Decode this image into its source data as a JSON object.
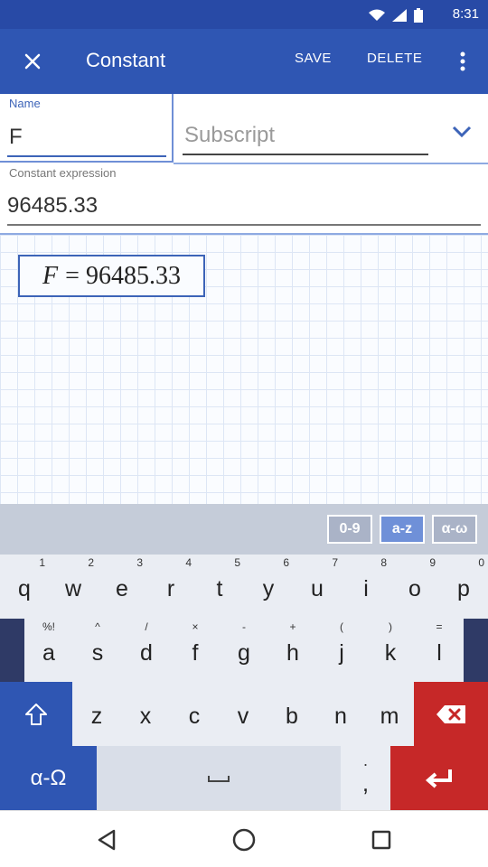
{
  "status_bar": {
    "time": "8:31"
  },
  "app_bar": {
    "title": "Constant",
    "save_label": "SAVE",
    "delete_label": "DELETE"
  },
  "form": {
    "name_label": "Name",
    "name_value": "F",
    "subscript_placeholder": "Subscript",
    "subscript_value": "",
    "expression_label": "Constant expression",
    "expression_value": "96485.33"
  },
  "preview": {
    "variable": "F",
    "equation_rest": "= 96485.33"
  },
  "keyboard": {
    "modes": [
      {
        "label": "0-9",
        "active": false
      },
      {
        "label": "a-z",
        "active": true
      },
      {
        "label": "α-ω",
        "active": false
      }
    ],
    "row1": [
      {
        "main": "q",
        "alt": "1"
      },
      {
        "main": "w",
        "alt": "2"
      },
      {
        "main": "e",
        "alt": "3"
      },
      {
        "main": "r",
        "alt": "4"
      },
      {
        "main": "t",
        "alt": "5"
      },
      {
        "main": "y",
        "alt": "6"
      },
      {
        "main": "u",
        "alt": "7"
      },
      {
        "main": "i",
        "alt": "8"
      },
      {
        "main": "o",
        "alt": "9"
      },
      {
        "main": "p",
        "alt": "0"
      }
    ],
    "row2": [
      {
        "main": "a",
        "alt": "%!"
      },
      {
        "main": "s",
        "alt": "^"
      },
      {
        "main": "d",
        "alt": "/"
      },
      {
        "main": "f",
        "alt": "×"
      },
      {
        "main": "g",
        "alt": "-"
      },
      {
        "main": "h",
        "alt": "+"
      },
      {
        "main": "j",
        "alt": "("
      },
      {
        "main": "k",
        "alt": ")"
      },
      {
        "main": "l",
        "alt": "="
      }
    ],
    "row3": [
      {
        "main": "z"
      },
      {
        "main": "x"
      },
      {
        "main": "c"
      },
      {
        "main": "v"
      },
      {
        "main": "b"
      },
      {
        "main": "n"
      },
      {
        "main": "m"
      }
    ],
    "greek_label": "α-Ω",
    "comma_main": ",",
    "comma_alt": "."
  },
  "icons": {
    "close": "close-icon",
    "overflow": "more-vert-icon",
    "chevron": "chevron-down-icon",
    "shift": "shift-arrow-icon",
    "backspace": "backspace-icon",
    "space": "space-bar-icon",
    "enter": "enter-icon",
    "nav_back": "back-triangle-icon",
    "nav_home": "home-circle-icon",
    "nav_recents": "recents-square-icon"
  },
  "colors": {
    "app_bar": "#2f56b3",
    "accent_blue": "#3d64b8",
    "key_red": "#c62828",
    "row_dark": "#2f3a66"
  }
}
